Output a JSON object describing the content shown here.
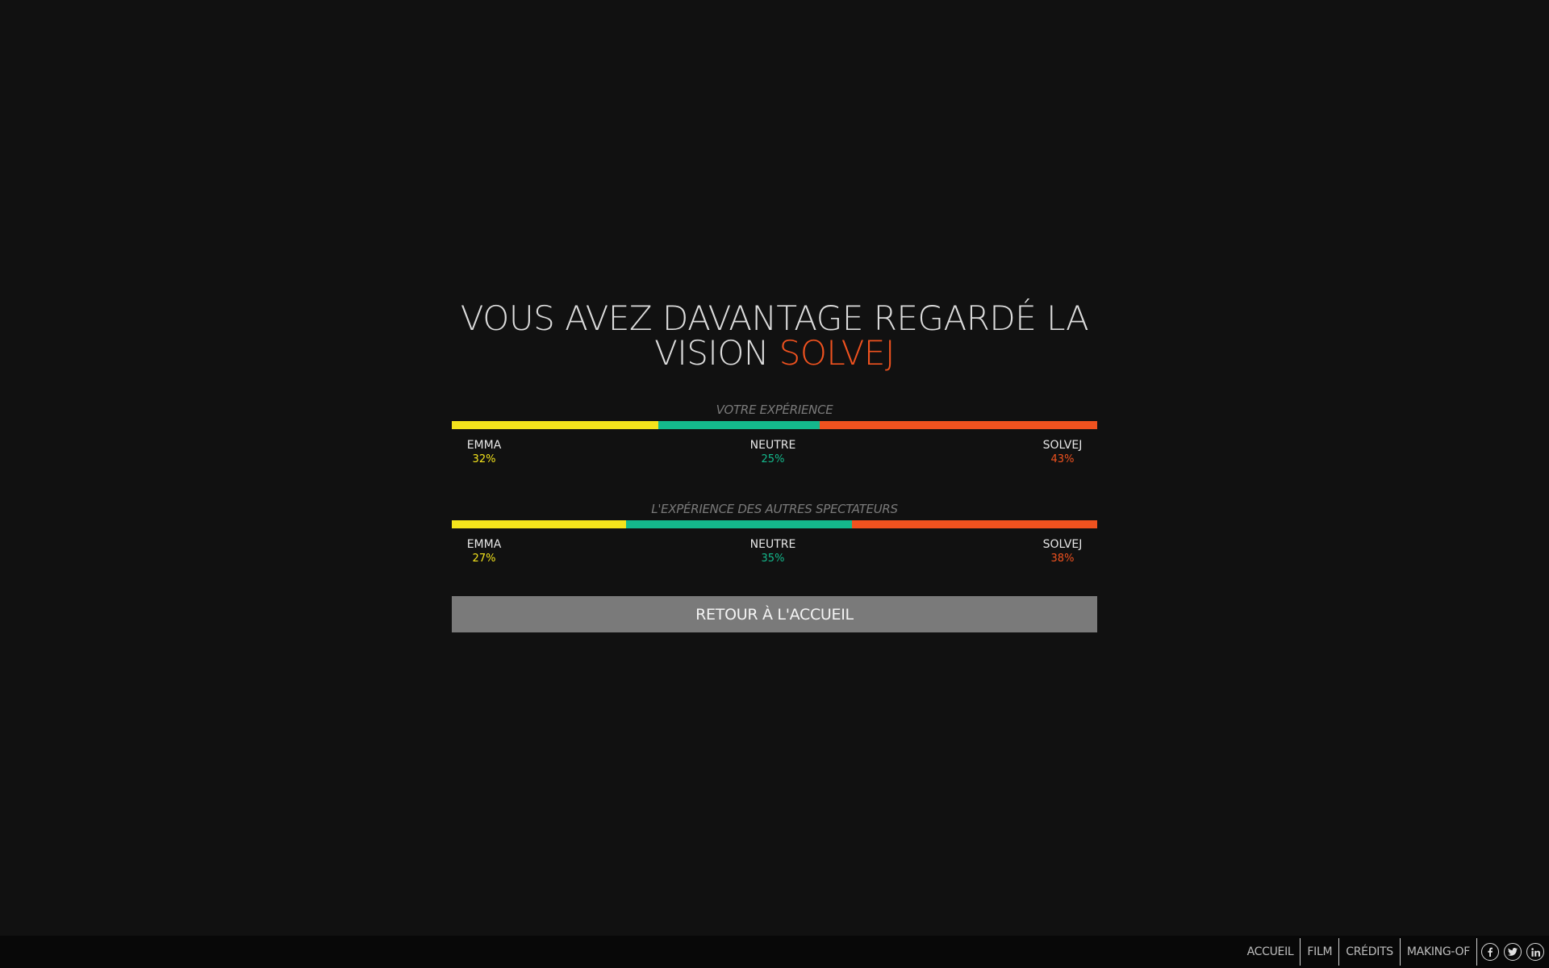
{
  "headline": {
    "text": "VOUS AVEZ DAVANTAGE REGARDÉ LA VISION",
    "accent": "SOLVEJ"
  },
  "colors": {
    "emma": "#f4e41c",
    "neutre": "#14b98c",
    "solvej": "#f0521f",
    "button": "#7a7a7a",
    "background": "#111111"
  },
  "chart_data": [
    {
      "type": "bar",
      "title": "VOTRE EXPÉRIENCE",
      "categories": [
        "EMMA",
        "NEUTRE",
        "SOLVEJ"
      ],
      "values": [
        32,
        25,
        43
      ],
      "labels": [
        "32%",
        "25%",
        "43%"
      ]
    },
    {
      "type": "bar",
      "title": "L'EXPÉRIENCE DES AUTRES SPECTATEURS",
      "categories": [
        "EMMA",
        "NEUTRE",
        "SOLVEJ"
      ],
      "values": [
        27,
        35,
        38
      ],
      "labels": [
        "27%",
        "35%",
        "38%"
      ]
    }
  ],
  "back_button": {
    "label": "RETOUR À L'ACCUEIL"
  },
  "footer": {
    "nav": [
      "ACCUEIL",
      "FILM",
      "CRÉDITS",
      "MAKING-OF"
    ],
    "social": [
      "facebook-icon",
      "twitter-icon",
      "linkedin-icon"
    ]
  }
}
